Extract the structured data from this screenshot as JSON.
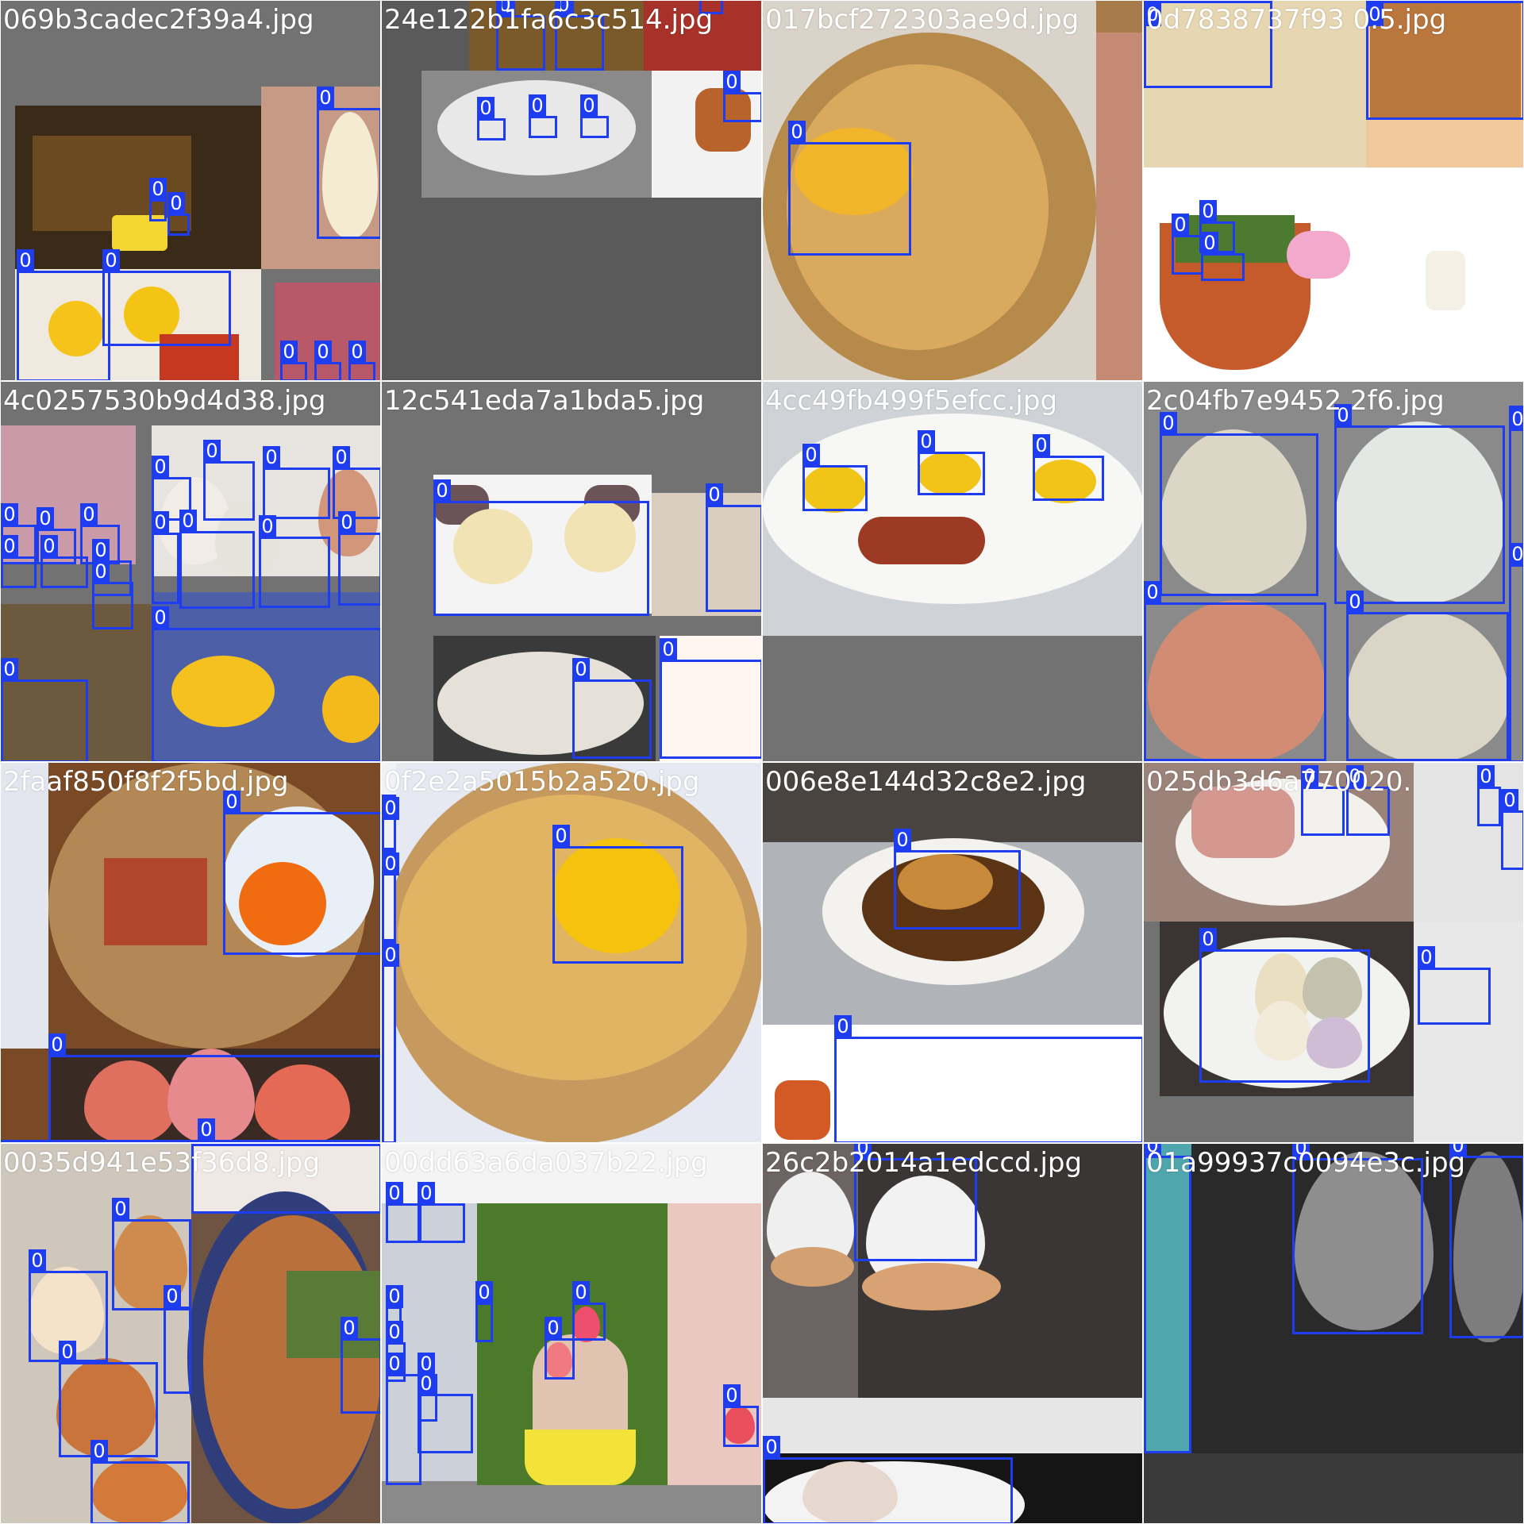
{
  "colors": {
    "box": "#1f3df0",
    "label_text": "#ffffff",
    "pad_gray": "#727272",
    "pad_dark": "#5a5a5a"
  },
  "tiles": [
    {
      "filename": "069b3cadec2f39a4.jpg",
      "labels": [
        "0",
        "0",
        "0",
        "0",
        "0",
        "0",
        "0",
        "0"
      ]
    },
    {
      "filename": "24e122b1fa6c3c514.jpg",
      "labels": [
        "0",
        "0",
        "0",
        "0",
        "0",
        "0",
        "0",
        "0",
        "0"
      ]
    },
    {
      "filename": "017bcf272303ae9d.jpg",
      "labels": [
        "0"
      ]
    },
    {
      "filename": "0d7838737f93 0.5.jpg",
      "labels": [
        "0",
        "0",
        "0",
        "0",
        "0"
      ]
    },
    {
      "filename": "4c0257530b9d4d38.jpg",
      "labels": [
        "0",
        "0",
        "0",
        "0",
        "0",
        "0",
        "0",
        "0",
        "0",
        "0",
        "0",
        "0",
        "0",
        "0",
        "0",
        "0",
        "0"
      ]
    },
    {
      "filename": "12c541eda7a1bda5.jpg",
      "labels": [
        "0",
        "0",
        "0",
        "0"
      ]
    },
    {
      "filename": "4cc49fb499f5efcc.jpg",
      "labels": [
        "0",
        "0",
        "0"
      ]
    },
    {
      "filename": "2c04fb7e9452 2f6.jpg",
      "labels": [
        "0",
        "0",
        "0",
        "0",
        "0",
        "0"
      ]
    },
    {
      "filename": "2faaf850f8f2f5bd.jpg",
      "labels": [
        "0",
        "0",
        "0"
      ]
    },
    {
      "filename": "0f2e2a5015b2a520.jpg",
      "labels": [
        "0",
        "0",
        "0",
        "0"
      ]
    },
    {
      "filename": "006e8e144d32c8e2.jpg",
      "labels": [
        "0",
        "0"
      ]
    },
    {
      "filename": "025db3d6a770020.",
      "labels": [
        "0",
        "0",
        "0",
        "0",
        "0",
        "0"
      ]
    },
    {
      "filename": "0035d941e53f36d8.jpg",
      "labels": [
        "0",
        "0",
        "0",
        "0",
        "0",
        "0",
        "0"
      ]
    },
    {
      "filename": "00dd63a6da037b22.jpg",
      "labels": [
        "0",
        "0",
        "0",
        "0",
        "0",
        "0",
        "0",
        "0",
        "0",
        "0",
        "0"
      ]
    },
    {
      "filename": "26c2b2014a1edccd.jpg",
      "labels": [
        "0",
        "0"
      ]
    },
    {
      "filename": "01a99937c0094e3c.jpg",
      "labels": [
        "0",
        "0",
        "0"
      ]
    }
  ]
}
